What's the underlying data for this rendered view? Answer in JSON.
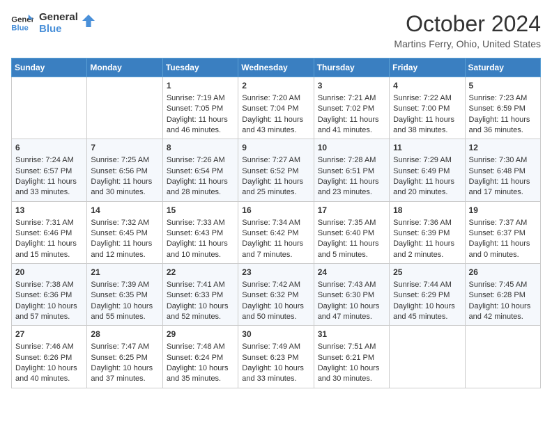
{
  "header": {
    "logo_line1": "General",
    "logo_line2": "Blue",
    "title": "October 2024",
    "location": "Martins Ferry, Ohio, United States"
  },
  "days_of_week": [
    "Sunday",
    "Monday",
    "Tuesday",
    "Wednesday",
    "Thursday",
    "Friday",
    "Saturday"
  ],
  "weeks": [
    [
      {
        "day": "",
        "sunrise": "",
        "sunset": "",
        "daylight": ""
      },
      {
        "day": "",
        "sunrise": "",
        "sunset": "",
        "daylight": ""
      },
      {
        "day": "1",
        "sunrise": "Sunrise: 7:19 AM",
        "sunset": "Sunset: 7:05 PM",
        "daylight": "Daylight: 11 hours and 46 minutes."
      },
      {
        "day": "2",
        "sunrise": "Sunrise: 7:20 AM",
        "sunset": "Sunset: 7:04 PM",
        "daylight": "Daylight: 11 hours and 43 minutes."
      },
      {
        "day": "3",
        "sunrise": "Sunrise: 7:21 AM",
        "sunset": "Sunset: 7:02 PM",
        "daylight": "Daylight: 11 hours and 41 minutes."
      },
      {
        "day": "4",
        "sunrise": "Sunrise: 7:22 AM",
        "sunset": "Sunset: 7:00 PM",
        "daylight": "Daylight: 11 hours and 38 minutes."
      },
      {
        "day": "5",
        "sunrise": "Sunrise: 7:23 AM",
        "sunset": "Sunset: 6:59 PM",
        "daylight": "Daylight: 11 hours and 36 minutes."
      }
    ],
    [
      {
        "day": "6",
        "sunrise": "Sunrise: 7:24 AM",
        "sunset": "Sunset: 6:57 PM",
        "daylight": "Daylight: 11 hours and 33 minutes."
      },
      {
        "day": "7",
        "sunrise": "Sunrise: 7:25 AM",
        "sunset": "Sunset: 6:56 PM",
        "daylight": "Daylight: 11 hours and 30 minutes."
      },
      {
        "day": "8",
        "sunrise": "Sunrise: 7:26 AM",
        "sunset": "Sunset: 6:54 PM",
        "daylight": "Daylight: 11 hours and 28 minutes."
      },
      {
        "day": "9",
        "sunrise": "Sunrise: 7:27 AM",
        "sunset": "Sunset: 6:52 PM",
        "daylight": "Daylight: 11 hours and 25 minutes."
      },
      {
        "day": "10",
        "sunrise": "Sunrise: 7:28 AM",
        "sunset": "Sunset: 6:51 PM",
        "daylight": "Daylight: 11 hours and 23 minutes."
      },
      {
        "day": "11",
        "sunrise": "Sunrise: 7:29 AM",
        "sunset": "Sunset: 6:49 PM",
        "daylight": "Daylight: 11 hours and 20 minutes."
      },
      {
        "day": "12",
        "sunrise": "Sunrise: 7:30 AM",
        "sunset": "Sunset: 6:48 PM",
        "daylight": "Daylight: 11 hours and 17 minutes."
      }
    ],
    [
      {
        "day": "13",
        "sunrise": "Sunrise: 7:31 AM",
        "sunset": "Sunset: 6:46 PM",
        "daylight": "Daylight: 11 hours and 15 minutes."
      },
      {
        "day": "14",
        "sunrise": "Sunrise: 7:32 AM",
        "sunset": "Sunset: 6:45 PM",
        "daylight": "Daylight: 11 hours and 12 minutes."
      },
      {
        "day": "15",
        "sunrise": "Sunrise: 7:33 AM",
        "sunset": "Sunset: 6:43 PM",
        "daylight": "Daylight: 11 hours and 10 minutes."
      },
      {
        "day": "16",
        "sunrise": "Sunrise: 7:34 AM",
        "sunset": "Sunset: 6:42 PM",
        "daylight": "Daylight: 11 hours and 7 minutes."
      },
      {
        "day": "17",
        "sunrise": "Sunrise: 7:35 AM",
        "sunset": "Sunset: 6:40 PM",
        "daylight": "Daylight: 11 hours and 5 minutes."
      },
      {
        "day": "18",
        "sunrise": "Sunrise: 7:36 AM",
        "sunset": "Sunset: 6:39 PM",
        "daylight": "Daylight: 11 hours and 2 minutes."
      },
      {
        "day": "19",
        "sunrise": "Sunrise: 7:37 AM",
        "sunset": "Sunset: 6:37 PM",
        "daylight": "Daylight: 11 hours and 0 minutes."
      }
    ],
    [
      {
        "day": "20",
        "sunrise": "Sunrise: 7:38 AM",
        "sunset": "Sunset: 6:36 PM",
        "daylight": "Daylight: 10 hours and 57 minutes."
      },
      {
        "day": "21",
        "sunrise": "Sunrise: 7:39 AM",
        "sunset": "Sunset: 6:35 PM",
        "daylight": "Daylight: 10 hours and 55 minutes."
      },
      {
        "day": "22",
        "sunrise": "Sunrise: 7:41 AM",
        "sunset": "Sunset: 6:33 PM",
        "daylight": "Daylight: 10 hours and 52 minutes."
      },
      {
        "day": "23",
        "sunrise": "Sunrise: 7:42 AM",
        "sunset": "Sunset: 6:32 PM",
        "daylight": "Daylight: 10 hours and 50 minutes."
      },
      {
        "day": "24",
        "sunrise": "Sunrise: 7:43 AM",
        "sunset": "Sunset: 6:30 PM",
        "daylight": "Daylight: 10 hours and 47 minutes."
      },
      {
        "day": "25",
        "sunrise": "Sunrise: 7:44 AM",
        "sunset": "Sunset: 6:29 PM",
        "daylight": "Daylight: 10 hours and 45 minutes."
      },
      {
        "day": "26",
        "sunrise": "Sunrise: 7:45 AM",
        "sunset": "Sunset: 6:28 PM",
        "daylight": "Daylight: 10 hours and 42 minutes."
      }
    ],
    [
      {
        "day": "27",
        "sunrise": "Sunrise: 7:46 AM",
        "sunset": "Sunset: 6:26 PM",
        "daylight": "Daylight: 10 hours and 40 minutes."
      },
      {
        "day": "28",
        "sunrise": "Sunrise: 7:47 AM",
        "sunset": "Sunset: 6:25 PM",
        "daylight": "Daylight: 10 hours and 37 minutes."
      },
      {
        "day": "29",
        "sunrise": "Sunrise: 7:48 AM",
        "sunset": "Sunset: 6:24 PM",
        "daylight": "Daylight: 10 hours and 35 minutes."
      },
      {
        "day": "30",
        "sunrise": "Sunrise: 7:49 AM",
        "sunset": "Sunset: 6:23 PM",
        "daylight": "Daylight: 10 hours and 33 minutes."
      },
      {
        "day": "31",
        "sunrise": "Sunrise: 7:51 AM",
        "sunset": "Sunset: 6:21 PM",
        "daylight": "Daylight: 10 hours and 30 minutes."
      },
      {
        "day": "",
        "sunrise": "",
        "sunset": "",
        "daylight": ""
      },
      {
        "day": "",
        "sunrise": "",
        "sunset": "",
        "daylight": ""
      }
    ]
  ]
}
